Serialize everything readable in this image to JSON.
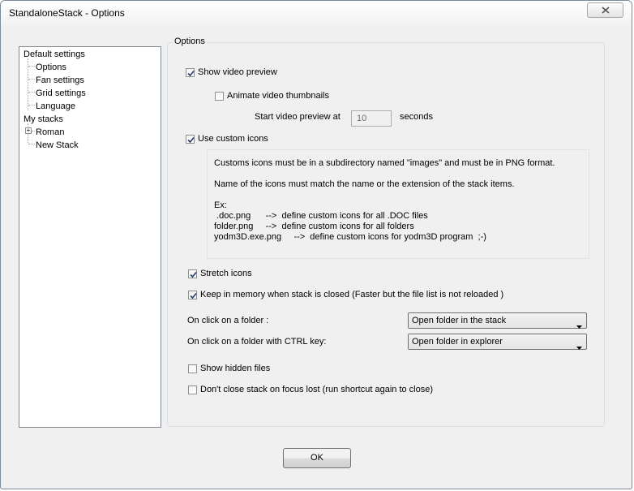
{
  "window": {
    "title": "StandaloneStack - Options",
    "close_icon": "close-icon"
  },
  "tree": {
    "items": [
      {
        "label": "Default settings"
      },
      {
        "label": "Options",
        "selected": true
      },
      {
        "label": "Fan settings"
      },
      {
        "label": "Grid settings"
      },
      {
        "label": "Language"
      },
      {
        "label": "My stacks"
      },
      {
        "label": "Roman",
        "expander": "+"
      },
      {
        "label": "New Stack"
      }
    ]
  },
  "options": {
    "group_title": "Options",
    "show_video_preview": {
      "label": "Show video preview",
      "checked": true
    },
    "animate_thumbnails": {
      "label": "Animate video thumbnails",
      "checked": false
    },
    "start_preview": {
      "prefix": "Start video preview at",
      "value": "10",
      "suffix": "seconds"
    },
    "use_custom_icons": {
      "label": "Use custom icons",
      "checked": true
    },
    "info_lines": [
      "Customs icons must be in a subdirectory named \"images\" and must be in PNG format.",
      "Name of the icons must match the name or the extension of the stack items.",
      "Ex:",
      " .doc.png      -->  define custom icons for all .DOC files",
      "folder.png     -->  define custom icons for all folders",
      "yodm3D.exe.png     -->  define custom icons for yodm3D program  ;-)"
    ],
    "stretch_icons": {
      "label": "Stretch icons",
      "checked": true
    },
    "keep_in_memory": {
      "label": "Keep in memory when stack is closed (Faster but the file list is not reloaded )",
      "checked": true
    },
    "click_folder": {
      "label": "On click on a folder :",
      "value": "Open folder in the stack"
    },
    "click_folder_ctrl": {
      "label": "On click on a folder with CTRL key:",
      "value": "Open folder in explorer"
    },
    "show_hidden": {
      "label": "Show hidden files",
      "checked": false
    },
    "dont_close": {
      "label": "Don't close stack on focus lost  (run shortcut again to close)",
      "checked": false
    }
  },
  "footer": {
    "ok_label": "OK"
  }
}
